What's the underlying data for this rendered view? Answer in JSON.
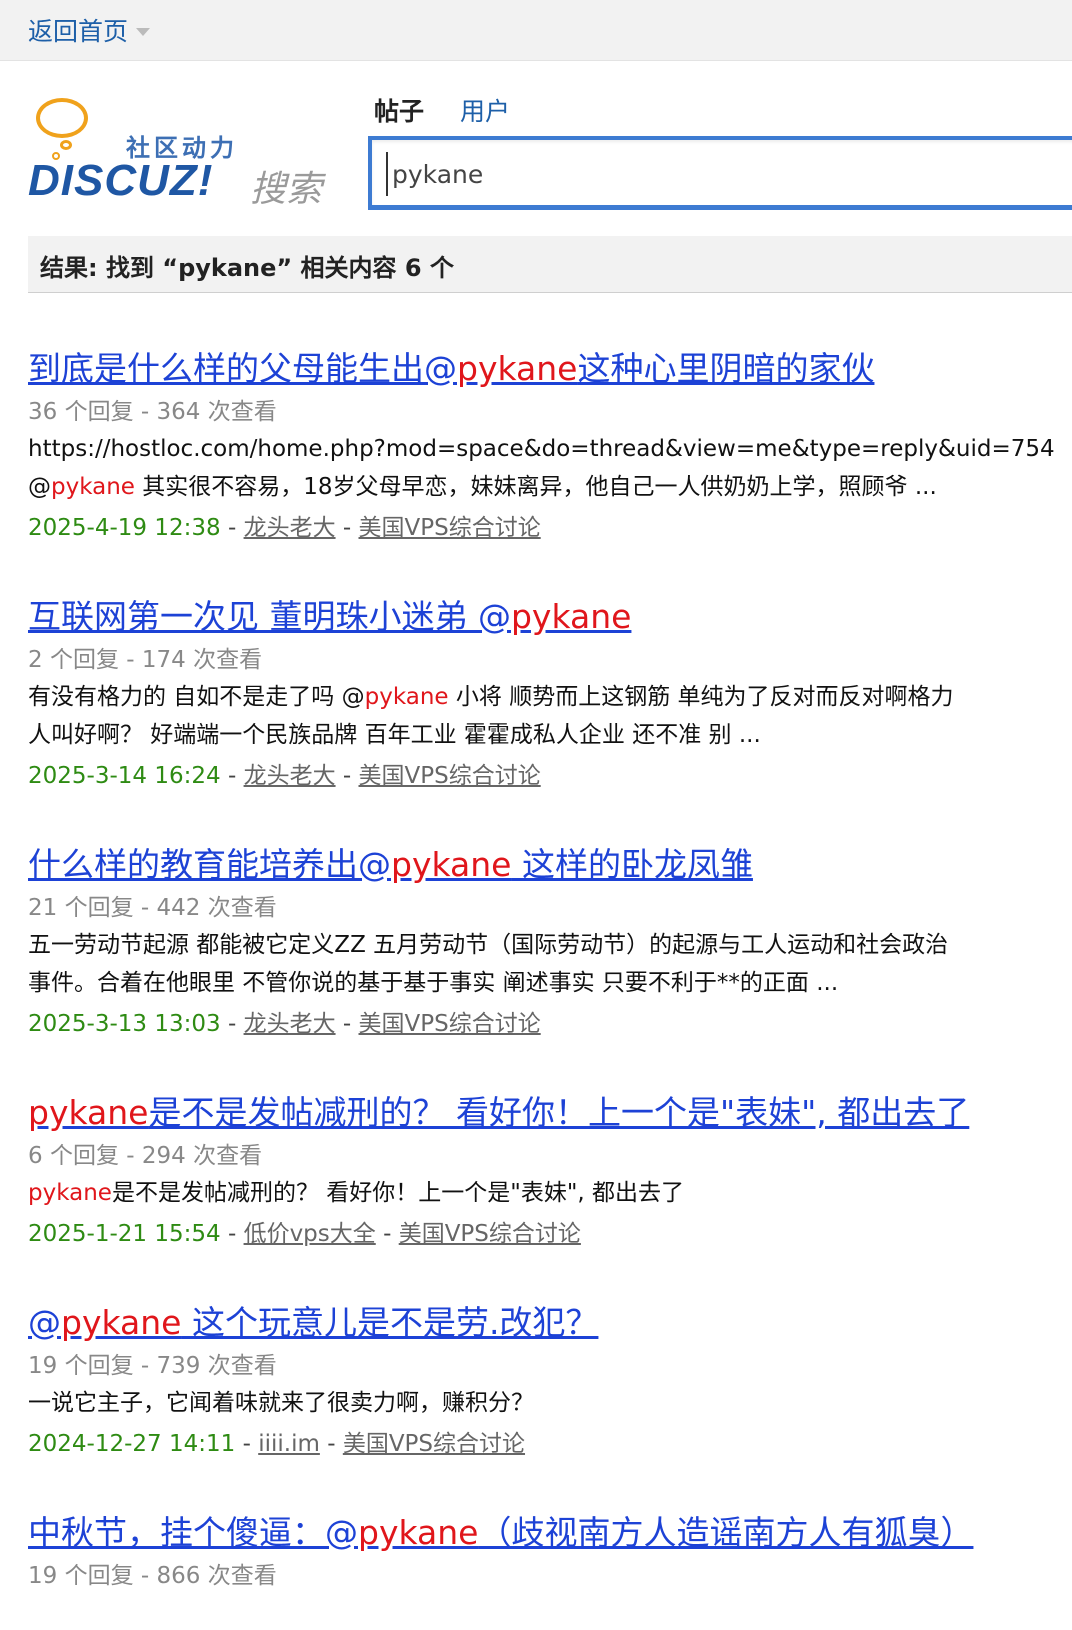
{
  "topbar": {
    "home_label": "返回首页"
  },
  "logo": {
    "slogan": "社区动力",
    "brand": "DISCUZ!",
    "search_word": "搜索"
  },
  "tabs": {
    "posts": "帖子",
    "users": "用户"
  },
  "search": {
    "value": "pykane"
  },
  "result_summary": "结果: 找到 “pykane” 相关内容 6 个",
  "results": [
    {
      "title_pre": "到底是什么样的父母能生出@",
      "title_hl": "pykane",
      "title_post": "这种心里阴暗的家伙",
      "stats": "36 个回复 - 364 次查看",
      "line1": "https://hostloc.com/home.php?mod=space&do=thread&view=me&type=reply&uid=754",
      "line2_pre": "@",
      "line2_hl": "pykane",
      "line2_post": " 其实很不容易，18岁父母早恋，妹妹离异，他自己一人供奶奶上学，照顾爷 ...",
      "date": "2025-4-19 12:38",
      "author": "龙头老大",
      "forum": "美国VPS综合讨论"
    },
    {
      "title_pre": "互联网第一次见 董明珠小迷弟 @",
      "title_hl": "pykane",
      "title_post": "",
      "stats": "2 个回复 - 174 次查看",
      "line1_pre": "有没有格力的 自如不是走了吗 @",
      "line1_hl": "pykane",
      "line1_post": " 小将 顺势而上这钢筋 单纯为了反对而反对啊格力",
      "line2": "人叫好啊？ 好端端一个民族品牌 百年工业 霍霍成私人企业 还不准 别 ...",
      "date": "2025-3-14 16:24",
      "author": "龙头老大",
      "forum": "美国VPS综合讨论"
    },
    {
      "title_pre": "什么样的教育能培养出@",
      "title_hl": "pykane",
      "title_post": " 这样的卧龙凤雏",
      "stats": "21 个回复 - 442 次查看",
      "line1": "五一劳动节起源 都能被它定义ZZ 五月劳动节（国际劳动节）的起源与工人运动和社会政治",
      "line2": "事件。合着在他眼里 不管你说的基于基于事实 阐述事实 只要不利于**的正面 ...",
      "date": "2025-3-13 13:03",
      "author": "龙头老大",
      "forum": "美国VPS综合讨论"
    },
    {
      "title_pre": "",
      "title_hl": "pykane",
      "title_post": "是不是发帖减刑的？ 看好你！上一个是\"表妹\", 都出去了",
      "stats": "6 个回复 - 294 次查看",
      "line1_pre": "",
      "line1_hl": "pykane",
      "line1_post": "是不是发帖减刑的？ 看好你！上一个是\"表妹\", 都出去了",
      "date": "2025-1-21 15:54",
      "author": "低价vps大全",
      "forum": "美国VPS综合讨论"
    },
    {
      "title_pre": "@",
      "title_hl": "pykane",
      "title_post": " 这个玩意儿是不是劳.改犯？ ",
      "stats": "19 个回复 - 739 次查看",
      "line1": "一说它主子，它闻着味就来了很卖力啊，赚积分？",
      "date": "2024-12-27 14:11",
      "author": "iiii.im",
      "forum": "美国VPS综合讨论"
    },
    {
      "title_pre": "中秋节，挂个傻逼：@",
      "title_hl": "pykane",
      "title_post": "（歧视南方人造谣南方人有狐臭）",
      "stats": "19 个回复 - 866 次查看"
    }
  ],
  "colors": {
    "link": "#1d42d6",
    "highlight": "#e0161b",
    "date": "#2e8b13",
    "accent": "#3d7bd2"
  }
}
